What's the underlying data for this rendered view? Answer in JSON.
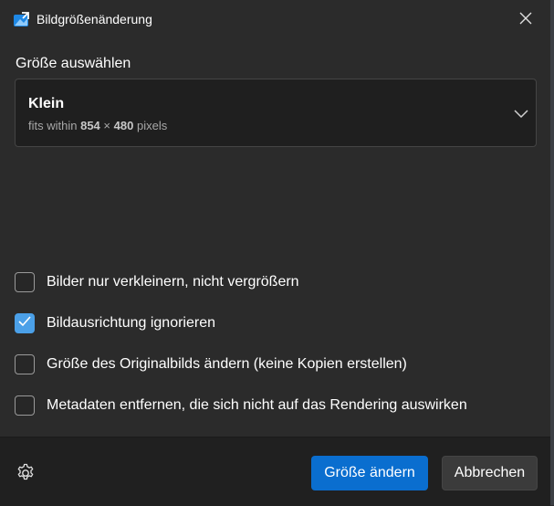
{
  "window": {
    "title": "Bildgrößenänderung"
  },
  "size_section": {
    "label": "Größe auswählen",
    "selected": {
      "name": "Klein",
      "desc_prefix": "fits within",
      "width": "854",
      "times": "×",
      "height": "480",
      "unit": "pixels"
    }
  },
  "options": [
    {
      "label": "Bilder nur verkleinern, nicht vergrößern",
      "checked": false
    },
    {
      "label": "Bildausrichtung ignorieren",
      "checked": true
    },
    {
      "label": "Größe des Originalbilds ändern (keine Kopien erstellen)",
      "checked": false
    },
    {
      "label": "Metadaten entfernen, die sich nicht auf das Rendering auswirken",
      "checked": false
    }
  ],
  "footer": {
    "primary_label": "Größe ändern",
    "secondary_label": "Abbrechen"
  },
  "colors": {
    "accent": "#0a6ecf",
    "checkbox_checked": "#4ba0e8",
    "background": "#2b2b2b",
    "footer": "#202020"
  },
  "icons": {
    "app": "image-resizer-icon",
    "close": "close-icon",
    "chevron": "chevron-down-icon",
    "settings": "gear-icon",
    "check": "checkmark-icon"
  }
}
